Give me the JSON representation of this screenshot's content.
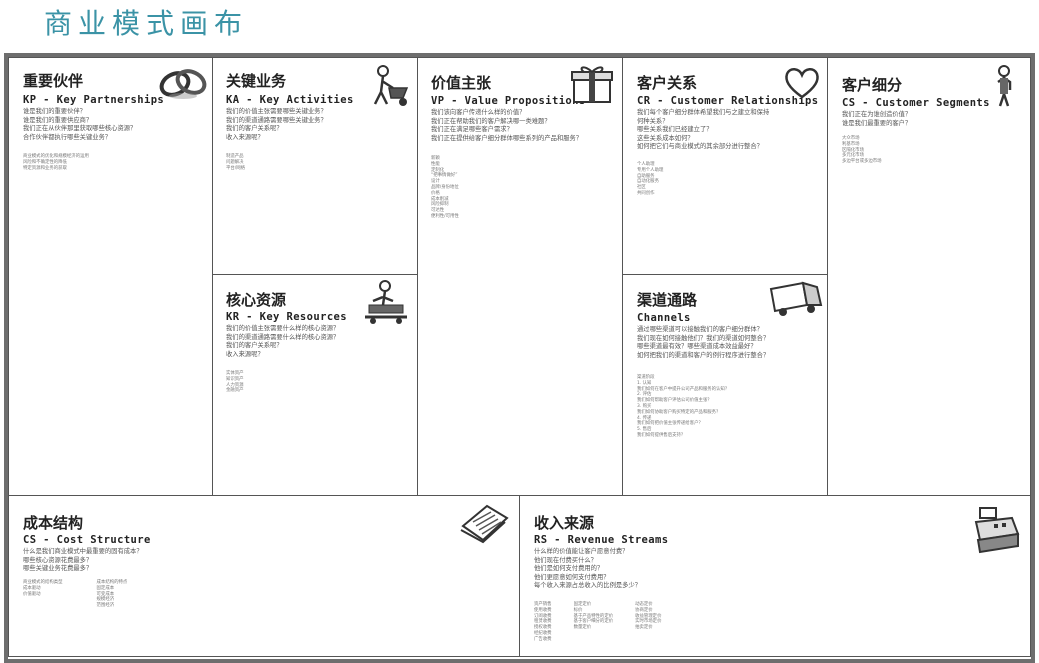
{
  "page_title": "商业模式画布",
  "blocks": {
    "kp": {
      "title": "重要伙伴",
      "subtitle": "KP - Key Partnerships",
      "icon": "chain-links-icon",
      "questions": [
        "谁是我们的重要伙伴？",
        "谁是我们的重要供应商？",
        "我们正在从伙伴那里获取哪些核心资源？",
        "合作伙伴都执行哪些关键业务？"
      ],
      "details": [
        "商业模式的优化和规模经济的运用",
        "风险和不确定性的降低",
        "特定资源和业务的获取"
      ]
    },
    "ka": {
      "title": "关键业务",
      "subtitle": "KA - Key Activities",
      "icon": "worker-wheelbarrow-icon",
      "questions": [
        "我们的价值主张需要哪些关键业务？",
        "我们的渠道通路需要哪些关键业务？",
        "我们的客户关系呢？",
        "收入来源呢？"
      ],
      "details": [
        "制造产品",
        "问题解决",
        "平台/网络"
      ]
    },
    "kr": {
      "title": "核心资源",
      "subtitle": "KR - Key Resources",
      "icon": "worker-forklift-icon",
      "questions": [
        "我们的价值主张需要什么样的核心资源？",
        "我们的渠道通路需要什么样的核心资源？",
        "我们的客户关系呢？",
        "收入来源呢？"
      ],
      "details": [
        "实体资产",
        "知识资产",
        "人力资源",
        "金融资产"
      ]
    },
    "vp": {
      "title": "价值主张",
      "subtitle": "VP - Value Propositions",
      "icon": "gift-box-icon",
      "questions": [
        "我们该向客户传递什么样的价值？",
        "我们正在帮助我们的客户解决哪一类难题？",
        "我们正在满足哪些客户需求？",
        "我们正在提供给客户细分群体哪些系列的产品和服务？"
      ],
      "details": [
        "新颖",
        "性能",
        "定制化",
        "“把事情做好”",
        "设计",
        "品牌/身份地位",
        "价格",
        "成本削减",
        "风险抑制",
        "可达性",
        "便利性/可用性"
      ]
    },
    "cr": {
      "title": "客户关系",
      "subtitle": "CR - Customer Relationships",
      "icon": "heart-icon",
      "questions": [
        "我们每个客户细分群体希望我们与之建立和保持",
        "何种关系？",
        "哪些关系我们已经建立了？",
        "这些关系成本如何？",
        "如何把它们与商业模式的其余部分进行整合？"
      ],
      "details": [
        "个人助理",
        "专用个人助理",
        "自助服务",
        "自动化服务",
        "社区",
        "共同创作"
      ]
    },
    "ch": {
      "title": "渠道通路",
      "subtitle": "Channels",
      "icon": "delivery-truck-icon",
      "questions": [
        "通过哪些渠道可以接触我们的客户细分群体？",
        "我们现在如何接触他们？我们的渠道如何整合？",
        "哪些渠道最有效？哪些渠道成本效益最好？",
        "如何把我们的渠道和客户的例行程序进行整合？"
      ],
      "details": [
        "渠道阶段",
        "1.   认知",
        "      我们如何在客户中提升公司产品和服务的认知？",
        "2.   评估",
        "      我们如何帮助客户评估公司价值主张？",
        "3.   购买",
        "      我们如何协助客户购买特定的产品和服务？",
        "4.   传递",
        "      我们如何把价值主张传递给客户？",
        "5.   售后",
        "      我们如何提供售后支持？"
      ]
    },
    "cs_seg": {
      "title": "客户细分",
      "subtitle": "CS - Customer Segments",
      "icon": "person-standing-icon",
      "questions": [
        "我们正在为谁创造价值？",
        "谁是我们最重要的客户？"
      ],
      "details": [
        "大众市场",
        "利基市场",
        "区隔化市场",
        "多元化市场",
        "多边平台或多边市场"
      ]
    },
    "cost": {
      "title": "成本结构",
      "subtitle": "CS - Cost Structure",
      "icon": "document-stack-icon",
      "questions": [
        "什么是我们商业模式中最重要的固有成本？",
        "哪些核心资源花费最多？",
        "哪些关键业务花费最多？"
      ],
      "details_col1": [
        "商业模式的结构类型",
        "成本驱动",
        "价值驱动"
      ],
      "details_col2": [
        "成本结构的特点",
        "固定成本",
        "可变成本",
        "规模经济",
        "范围经济"
      ]
    },
    "rev": {
      "title": "收入来源",
      "subtitle": "RS - Revenue Streams",
      "icon": "cash-register-icon",
      "questions": [
        "什么样的价值能让客户愿意付费？",
        "他们现在付费买什么？",
        "他们是如何支付费用的？",
        "他们更愿意如何支付费用？",
        "每个收入来源占总收入的比例是多少？"
      ],
      "details_col1": [
        "资产销售",
        "使用收费",
        "订阅收费",
        "租赁收费",
        "授权收费",
        "经纪收费",
        "广告收费"
      ],
      "details_col2": [
        "固定定价",
        "标价",
        "基于产品特性的定价",
        "基于客户细分的定价",
        "数量定价"
      ],
      "details_col3": [
        "动态定价",
        "协商定价",
        "收益管理定价",
        "实时市场定价",
        "拍卖定价"
      ]
    }
  },
  "colors": {
    "title": "#3b93a6",
    "frame": "#6e6e6e",
    "border": "#555555"
  }
}
